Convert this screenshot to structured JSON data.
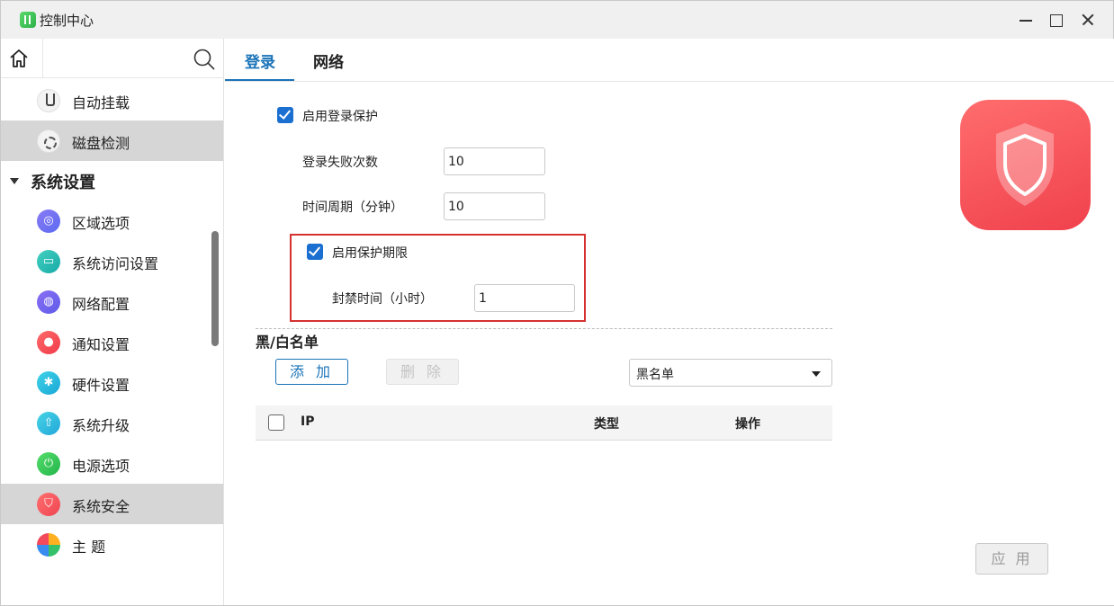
{
  "window": {
    "title": "控制中心",
    "app_icon": "control-center-icon",
    "controls": [
      "minimize-icon",
      "maximize-icon",
      "close-icon"
    ]
  },
  "sidebar": {
    "home_icon": "home-icon",
    "search_icon": "search-icon",
    "items_above": [
      {
        "label": "自动挂载",
        "icon": "mount-icon",
        "active": false
      },
      {
        "label": "磁盘检测",
        "icon": "disk-check-icon",
        "active": true
      }
    ],
    "group": {
      "label": "系统设置",
      "expanded": true
    },
    "items": [
      {
        "label": "区域选项",
        "icon": "region-icon",
        "active": false
      },
      {
        "label": "系统访问设置",
        "icon": "access-icon",
        "active": false
      },
      {
        "label": "网络配置",
        "icon": "network-icon",
        "active": false
      },
      {
        "label": "通知设置",
        "icon": "bell-icon",
        "active": false
      },
      {
        "label": "硬件设置",
        "icon": "hardware-icon",
        "active": false
      },
      {
        "label": "系统升级",
        "icon": "upgrade-icon",
        "active": false
      },
      {
        "label": "电源选项",
        "icon": "power-icon",
        "active": false
      },
      {
        "label": "系统安全",
        "icon": "shield-icon",
        "active": true
      },
      {
        "label": "主 题",
        "icon": "theme-icon",
        "active": false
      }
    ]
  },
  "tabs": [
    {
      "label": "登录",
      "active": true
    },
    {
      "label": "网络",
      "active": false
    }
  ],
  "login_protection": {
    "enable_label": "启用登录保护",
    "enabled": true,
    "fail_count_label": "登录失败次数",
    "fail_count_value": "10",
    "period_label": "时间周期（分钟）",
    "period_value": "10",
    "limit_enable_label": "启用保护期限",
    "limit_enabled": true,
    "ban_time_label": "封禁时间（小时）",
    "ban_time_value": "1"
  },
  "blacklist": {
    "title": "黑/白名单",
    "add_label": "添 加",
    "delete_label": "删 除",
    "list_type": "黑名单",
    "columns": [
      "IP",
      "类型",
      "操作"
    ],
    "rows": []
  },
  "apply_label": "应 用",
  "colors": {
    "accent": "#1a73b8",
    "checkbox": "#1a6fd0",
    "highlight_box": "#d63131",
    "security_badge": "#f0414d",
    "active_item_bg": "#d6d6d6"
  }
}
